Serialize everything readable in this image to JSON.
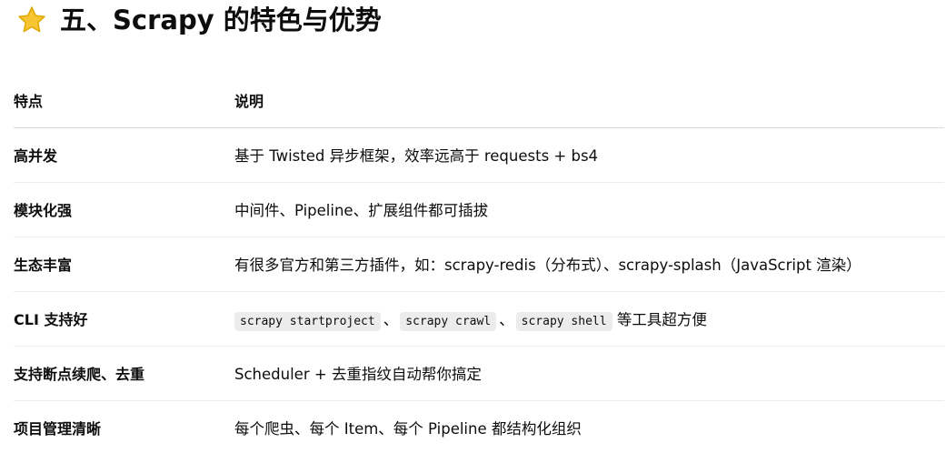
{
  "heading": {
    "icon": "star-icon",
    "text": "五、Scrapy 的特色与优势"
  },
  "table": {
    "headers": [
      "特点",
      "说明"
    ],
    "rows": [
      {
        "feature": "高并发",
        "desc": "基于 Twisted 异步框架，效率远高于 requests + bs4"
      },
      {
        "feature": "模块化强",
        "desc": "中间件、Pipeline、扩展组件都可插拔"
      },
      {
        "feature": "生态丰富",
        "desc": "有很多官方和第三方插件，如：scrapy-redis（分布式）、scrapy-splash（JavaScript 渲染）"
      },
      {
        "feature": "CLI 支持好",
        "codes": [
          "scrapy startproject",
          "scrapy crawl",
          "scrapy shell"
        ],
        "separator": "、",
        "suffix": "等工具超方便"
      },
      {
        "feature": "支持断点续爬、去重",
        "desc": "Scheduler + 去重指纹自动帮你搞定"
      },
      {
        "feature": "项目管理清晰",
        "desc": "每个爬虫、每个 Item、每个 Pipeline 都结构化组织"
      }
    ]
  },
  "colors": {
    "star": "#f7c531",
    "star_outline": "#e0a800",
    "code_bg": "#ececec",
    "divider": "#ececec"
  }
}
